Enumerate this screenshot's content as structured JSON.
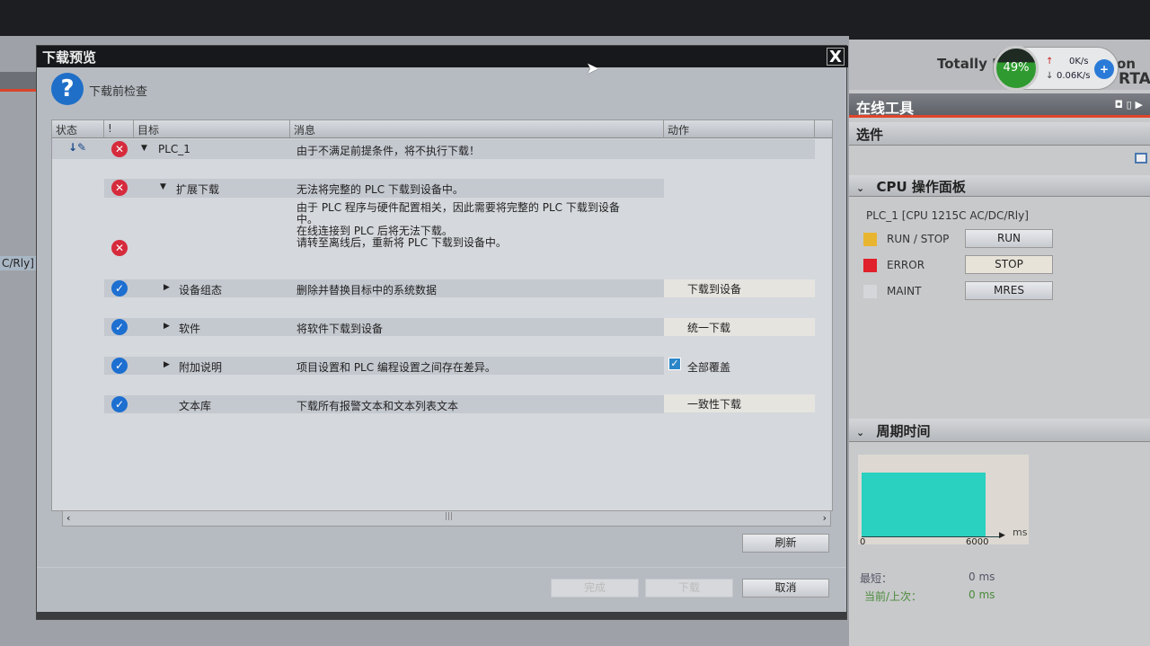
{
  "dialog": {
    "title": "下载预览",
    "subtitle": "下载前检查",
    "close": "X",
    "columns": [
      "状态",
      "!",
      "目标",
      "消息",
      "动作"
    ],
    "rows": [
      {
        "status_icon": "download-offline-icon",
        "severity": "error",
        "target": "PLC_1",
        "expand": "expanded",
        "message": "由于不满足前提条件，将不执行下载！",
        "action": ""
      },
      {
        "severity": "error",
        "target": "扩展下载",
        "expand": "expanded",
        "message": "无法将完整的 PLC 下载到设备中。",
        "action": ""
      },
      {
        "severity": "error",
        "target": "",
        "message_lines": [
          "由于 PLC 程序与硬件配置相关，因此需要将完整的 PLC 下载到设备",
          "中。",
          "在线连接到 PLC 后将无法下载。",
          "请转至离线后，重新将 PLC 下载到设备中。"
        ],
        "action": ""
      },
      {
        "severity": "ok",
        "target": "设备组态",
        "expand": "collapsed",
        "message": "删除并替换目标中的系统数据",
        "action": "下载到设备"
      },
      {
        "severity": "ok",
        "target": "软件",
        "expand": "collapsed",
        "message": "将软件下载到设备",
        "action": "统一下载"
      },
      {
        "severity": "ok",
        "target": "附加说明",
        "expand": "collapsed",
        "message": "项目设置和 PLC 编程设置之间存在差异。",
        "action": "全部覆盖",
        "action_checked": true
      },
      {
        "severity": "ok",
        "target": "文本库",
        "message": "下载所有报警文本和文本列表文本",
        "action": "一致性下载"
      }
    ],
    "buttons": {
      "refresh": "刷新",
      "finish": "完成",
      "download": "下载",
      "cancel": "取消"
    },
    "buttons_disabled": [
      "完成",
      "下载"
    ]
  },
  "background": {
    "left_label": "C/Rly]",
    "brand_partial": "Totally I",
    "brand_partial2": "on",
    "brand_partial3": "RTA"
  },
  "net_widget": {
    "percent": "49%",
    "up": "0K/s",
    "down": "0.06K/s"
  },
  "online_tools": {
    "title": "在线工具",
    "options": "选件",
    "cpu_panel": {
      "title": "CPU 操作面板",
      "device": "PLC_1 [CPU 1215C AC/DC/Rly]",
      "leds": [
        {
          "label": "RUN / STOP",
          "color": "#e8b530"
        },
        {
          "label": "ERROR",
          "color": "#e0202a"
        },
        {
          "label": "MAINT",
          "color": "#d4d6d9"
        }
      ],
      "buttons": [
        "RUN",
        "STOP",
        "MRES"
      ]
    },
    "cycle_time": {
      "title": "周期时间",
      "axis_min": "0",
      "axis_max": "6000",
      "unit": "ms",
      "bar_color": "#2ad0c0",
      "stats": [
        {
          "label": "最短：",
          "value": "0 ms"
        },
        {
          "label": "当前/上次：",
          "value": "0 ms"
        }
      ]
    }
  }
}
